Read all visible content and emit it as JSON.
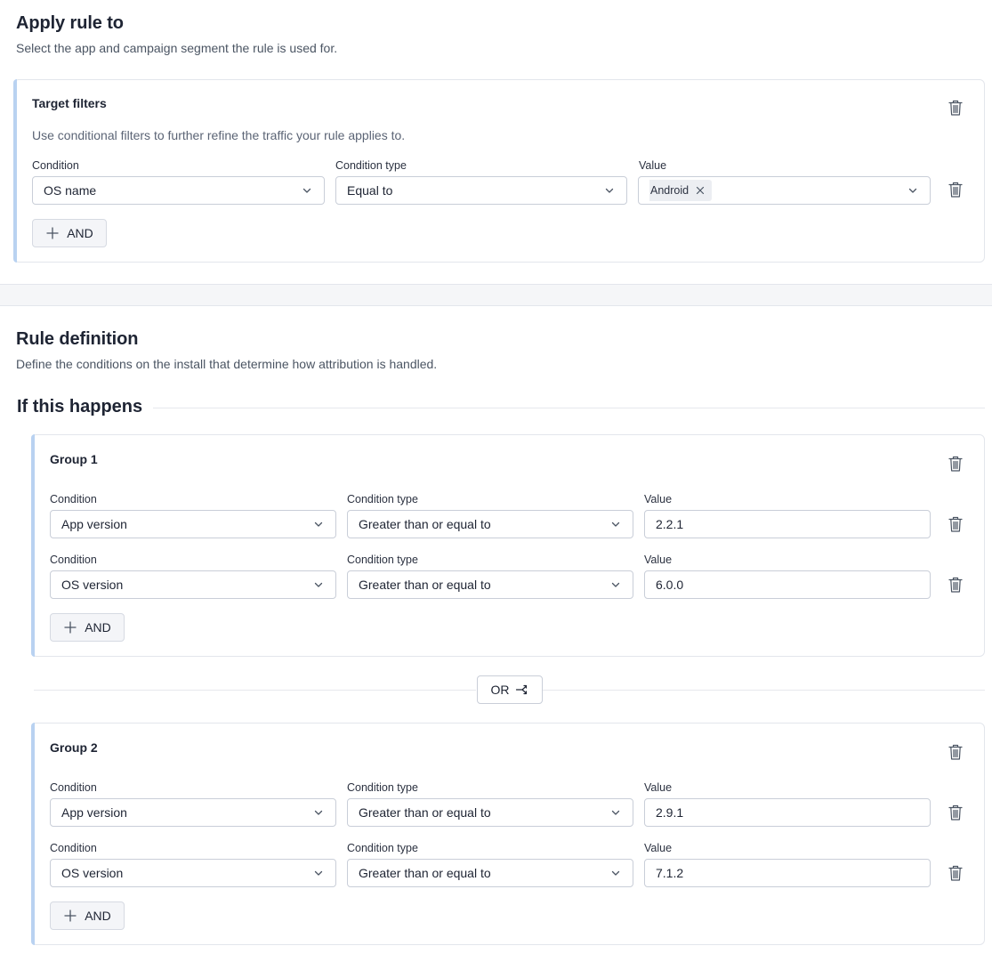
{
  "apply": {
    "title": "Apply rule to",
    "description": "Select the app and campaign segment the rule is used for.",
    "target_filters": {
      "title": "Target filters",
      "description": "Use conditional filters to further refine the traffic your rule applies to.",
      "condition_label": "Condition",
      "condition_type_label": "Condition type",
      "value_label": "Value",
      "condition": "OS name",
      "condition_type": "Equal to",
      "value_chip": "Android",
      "and_label": "AND"
    }
  },
  "rule": {
    "title": "Rule definition",
    "description": "Define the conditions on the install that determine how attribution is handled.",
    "if_heading": "If this happens",
    "or_label": "OR",
    "groups": [
      {
        "title": "Group 1",
        "rows": [
          {
            "condition_label": "Condition",
            "condition_type_label": "Condition type",
            "value_label": "Value",
            "condition": "App version",
            "condition_type": "Greater than or equal to",
            "value": "2.2.1"
          },
          {
            "condition_label": "Condition",
            "condition_type_label": "Condition type",
            "value_label": "Value",
            "condition": "OS version",
            "condition_type": "Greater than or equal to",
            "value": "6.0.0"
          }
        ],
        "and_label": "AND"
      },
      {
        "title": "Group 2",
        "rows": [
          {
            "condition_label": "Condition",
            "condition_type_label": "Condition type",
            "value_label": "Value",
            "condition": "App version",
            "condition_type": "Greater than or equal to",
            "value": "2.9.1"
          },
          {
            "condition_label": "Condition",
            "condition_type_label": "Condition type",
            "value_label": "Value",
            "condition": "OS version",
            "condition_type": "Greater than or equal to",
            "value": "7.1.2"
          }
        ],
        "and_label": "AND"
      }
    ]
  },
  "icons": {
    "trash": "trash-icon",
    "chevron": "chevron-down-icon",
    "plus": "plus-icon",
    "close": "close-icon",
    "or_branch": "branch-icon"
  },
  "colors": {
    "accent_bar": "#b9d2f1",
    "border": "#e3e6ec",
    "text": "#1e2433"
  }
}
